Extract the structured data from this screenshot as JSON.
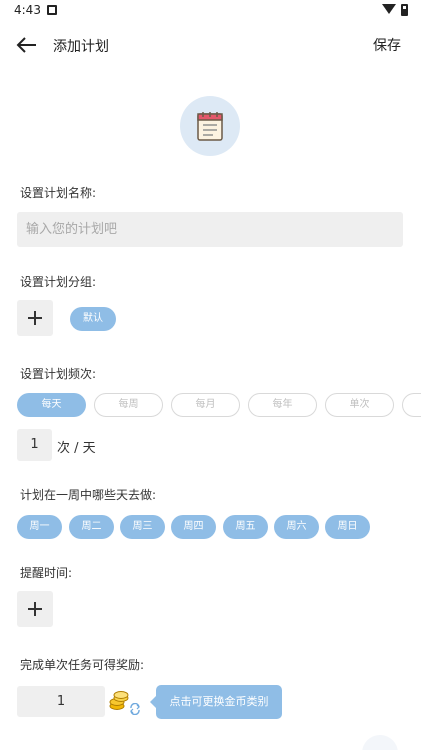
{
  "status_bar": {
    "time": "4:43"
  },
  "appbar": {
    "title": "添加计划",
    "save_label": "保存"
  },
  "plan_name": {
    "label": "设置计划名称:",
    "placeholder": "输入您的计划吧"
  },
  "group": {
    "label": "设置计划分组:",
    "chips": [
      "默认"
    ]
  },
  "frequency": {
    "label": "设置计划频次:",
    "options": [
      "每天",
      "每周",
      "每月",
      "每年",
      "单次"
    ],
    "selected": "每天",
    "count": "1",
    "unit": "次 / 天"
  },
  "weekdays": {
    "label": "计划在一周中哪些天去做:",
    "days": [
      "周一",
      "周二",
      "周三",
      "周四",
      "周五",
      "周六",
      "周日"
    ]
  },
  "reminder": {
    "label": "提醒时间:"
  },
  "reward": {
    "label": "完成单次任务可得奖励:",
    "value": "1",
    "tooltip": "点击可更换金币类别"
  },
  "colors": {
    "accent": "#8fbde6",
    "icon_bg": "#dde9f5",
    "field_bg": "#efefef"
  }
}
